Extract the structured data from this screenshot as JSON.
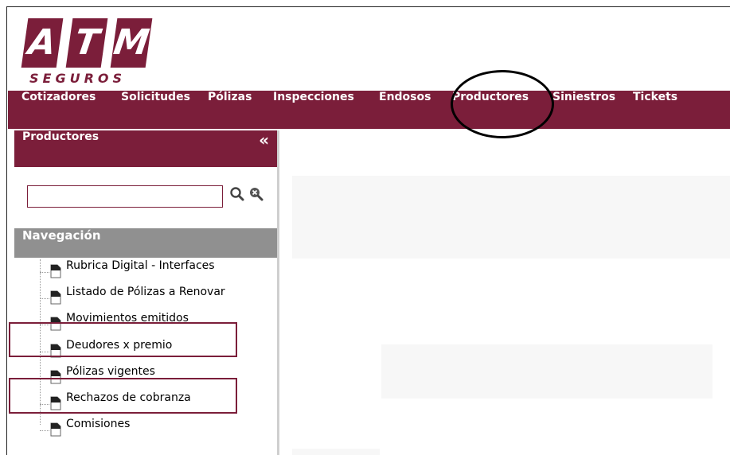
{
  "logo": {
    "letters": [
      "A",
      "T",
      "M"
    ],
    "tagline": "SEGUROS",
    "brand_color": "#7b1e3a"
  },
  "topnav": {
    "items": [
      {
        "label": "Cotizadores"
      },
      {
        "label": "Solicitudes"
      },
      {
        "label": "Pólizas"
      },
      {
        "label": "Inspecciones"
      },
      {
        "label": "Endosos"
      },
      {
        "label": "Productores"
      },
      {
        "label": "Siniestros"
      },
      {
        "label": "Tickets"
      }
    ],
    "highlighted": "Productores"
  },
  "sidebar": {
    "title": "Productores",
    "collapse_glyph": "«",
    "search": {
      "value": "",
      "placeholder": ""
    },
    "icons": [
      "search-icon",
      "clear-search-icon"
    ],
    "navigation": {
      "title": "Navegación",
      "items": [
        {
          "label": "Rubrica Digital - Interfaces"
        },
        {
          "label": "Listado de Pólizas a Renovar"
        },
        {
          "label": "Movimientos emitidos"
        },
        {
          "label": "Deudores x premio"
        },
        {
          "label": "Pólizas vigentes"
        },
        {
          "label": "Rechazos de cobranza"
        },
        {
          "label": "Comisiones"
        }
      ],
      "highlighted": [
        "Deudores x premio",
        "Rechazos de cobranza"
      ]
    }
  },
  "colors": {
    "accent": "#7b1e3a",
    "section_header": "#909090",
    "annotation": "#000000"
  }
}
